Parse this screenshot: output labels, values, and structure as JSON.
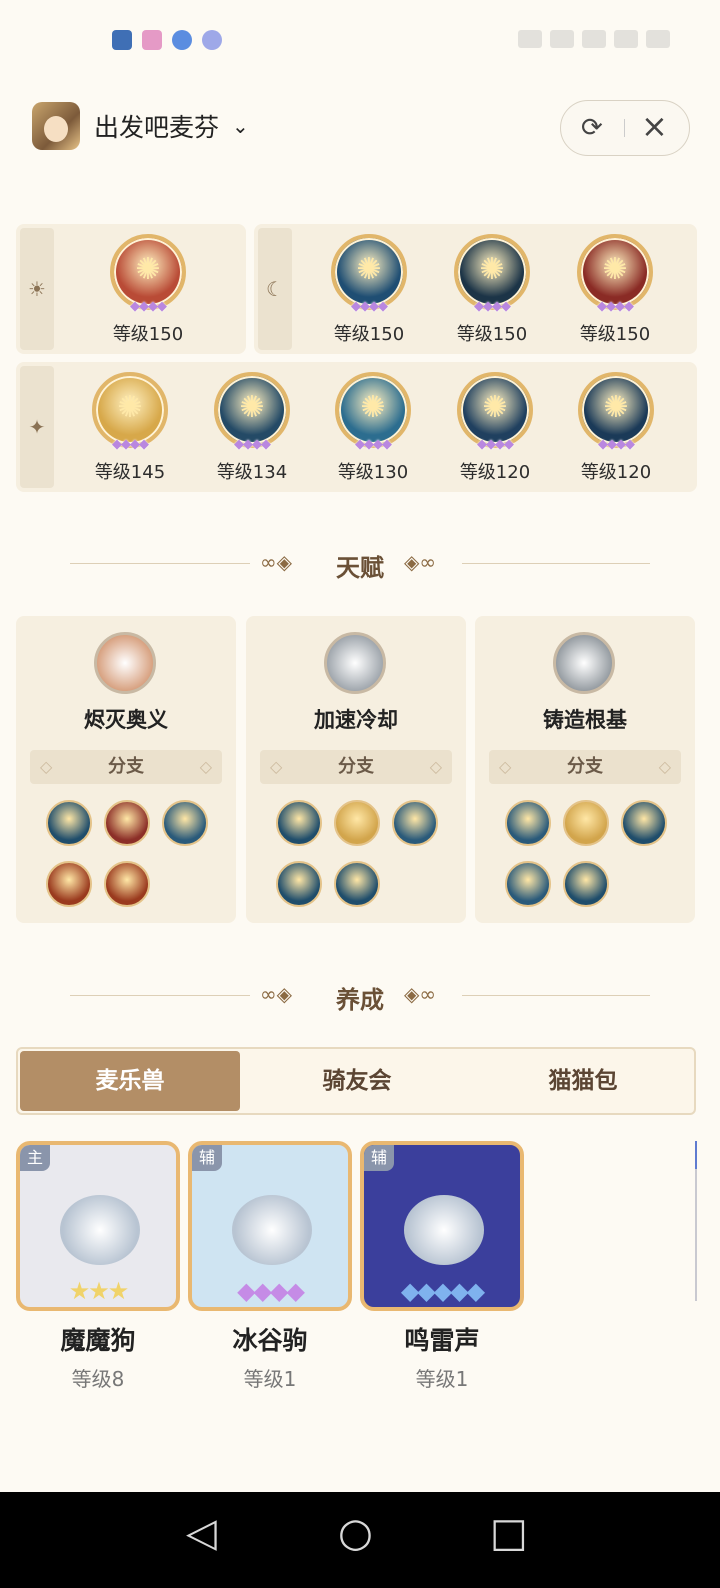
{
  "header": {
    "app_name": "出发吧麦芬",
    "chevron": "chevron-down-icon"
  },
  "skills": {
    "sun_row": [
      {
        "level": "等级150",
        "color": "#b94b36"
      }
    ],
    "moon_row": [
      {
        "level": "等级150",
        "color": "#1f4e73"
      },
      {
        "level": "等级150",
        "color": "#1c3447"
      },
      {
        "level": "等级150",
        "color": "#8a2b25"
      }
    ],
    "star_row": [
      {
        "level": "等级145",
        "color": "#d7a84a"
      },
      {
        "level": "等级134",
        "color": "#244a66"
      },
      {
        "level": "等级130",
        "color": "#2c6d8f"
      },
      {
        "level": "等级120",
        "color": "#20405f"
      },
      {
        "level": "等级120",
        "color": "#1b3a58"
      }
    ]
  },
  "sections": {
    "talent_title": "天赋",
    "nurture_title": "养成"
  },
  "talents": [
    {
      "name": "烬灭奥义",
      "branch": "分支",
      "icon_color": "#d59b78",
      "minis": [
        "#1f4d6b",
        "#8c2f28",
        "#2a5a7a",
        "#9a3a1e",
        "#9a3a1e"
      ]
    },
    {
      "name": "加速冷却",
      "branch": "分支",
      "icon_color": "#9aa1a8",
      "minis": [
        "#1f4d6b",
        "#d2a54c",
        "#2a5a7a",
        "#1f4d6b",
        "#1f4d6b"
      ]
    },
    {
      "name": "铸造根基",
      "branch": "分支",
      "icon_color": "#8f969c",
      "minis": [
        "#2a5a7a",
        "#d2a54c",
        "#1f4d6b",
        "#2a5a7a",
        "#1f4d6b"
      ]
    }
  ],
  "tabs": [
    "麦乐兽",
    "骑友会",
    "猫猫包"
  ],
  "pets": [
    {
      "badge": "主",
      "name": "魔魔狗",
      "level": "等级8",
      "stars": "★★★",
      "star_color": "#f0d36a",
      "bg": "#e9e9ee"
    },
    {
      "badge": "辅",
      "name": "冰谷驹",
      "level": "等级1",
      "stars": "◆◆◆◆",
      "star_color": "#c58be6",
      "bg": "#cfe4f2"
    },
    {
      "badge": "辅",
      "name": "鸣雷声",
      "level": "等级1",
      "stars": "◆◆◆◆◆",
      "star_color": "#7fb2ee",
      "bg": "#3b3f9c"
    }
  ]
}
